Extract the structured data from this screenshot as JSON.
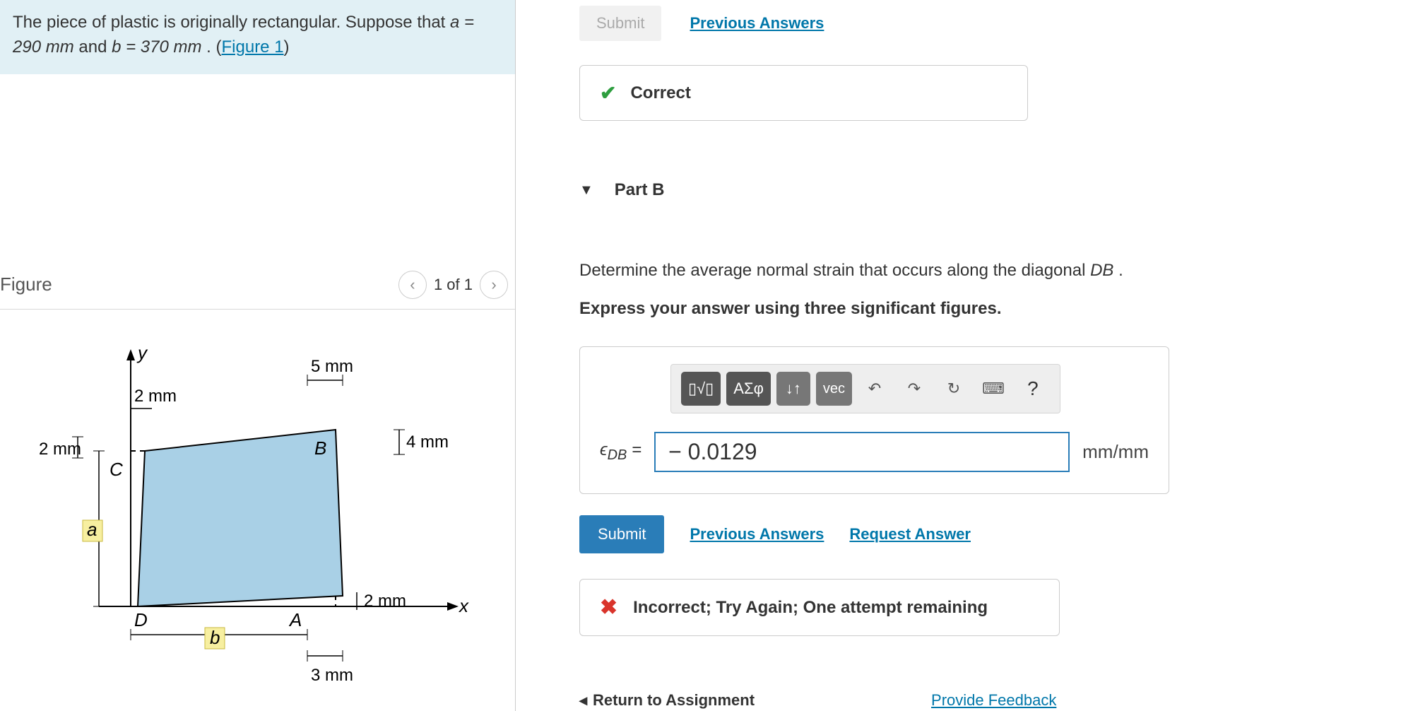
{
  "problem": {
    "text_prefix": "The piece of plastic is originally rectangular. Suppose that ",
    "a_expr": "a = 290 mm",
    "mid": " and ",
    "b_expr": "b = 370 mm",
    "suffix": " . (",
    "figure_link": "Figure 1",
    "close": ")"
  },
  "figure": {
    "title": "Figure",
    "pager": "1 of 1",
    "labels": {
      "y": "y",
      "x": "x",
      "a": "a",
      "b": "b",
      "A": "A",
      "B": "B",
      "C": "C",
      "D": "D",
      "d5mm": "5 mm",
      "d2mm_top": "2 mm",
      "d4mm": "4 mm",
      "d2mm_left": "2 mm",
      "d2mm_right": "2 mm",
      "d3mm": "3 mm"
    }
  },
  "partA": {
    "submit": "Submit",
    "prev": "Previous Answers",
    "correct": "Correct"
  },
  "partB": {
    "header": "Part B",
    "instr1_prefix": "Determine the average normal strain that occurs along the diagonal ",
    "instr1_var": "DB",
    "instr1_suffix": ".",
    "instr2": "Express your answer using three significant figures.",
    "toolbar": {
      "template": "▯√▯",
      "greek": "ΑΣφ",
      "updown": "↓↑",
      "vec": "vec",
      "undo": "↶",
      "redo": "↷",
      "reset": "↻",
      "keyboard": "⌨",
      "help": "?"
    },
    "var_label_html": "ϵ",
    "var_sub": "DB",
    "equals": " = ",
    "value": "− 0.0129",
    "unit": "mm/mm",
    "submit": "Submit",
    "prev": "Previous Answers",
    "request": "Request Answer",
    "incorrect": "Incorrect; Try Again; One attempt remaining"
  },
  "footer": {
    "return": "Return to Assignment",
    "feedback": "Provide Feedback"
  }
}
